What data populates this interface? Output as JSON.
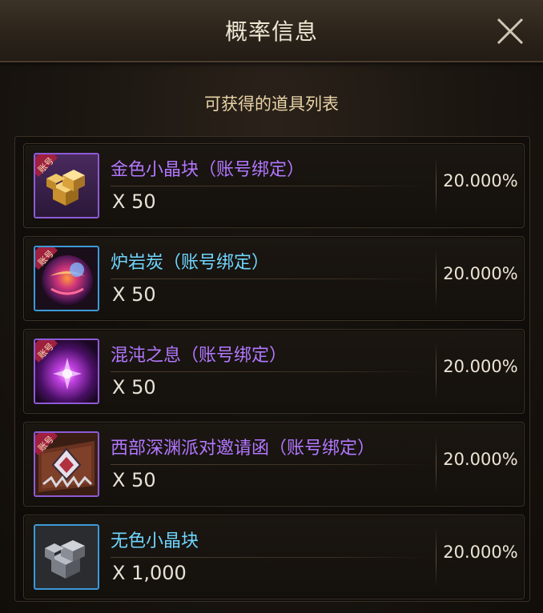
{
  "dialog": {
    "title": "概率信息",
    "subtitle": "可获得的道具列表"
  },
  "items": [
    {
      "name": "金色小晶块（账号绑定）",
      "quantity": "X 50",
      "probability": "20.000%",
      "name_color": "#b277ff",
      "frame_color": "#8c5bd6",
      "badge": "账号",
      "icon": "gold-crystal-blocks-icon"
    },
    {
      "name": "炉岩炭（账号绑定）",
      "quantity": "X 50",
      "probability": "20.000%",
      "name_color": "#6fd6ff",
      "frame_color": "#3c9ad8",
      "badge": "账号",
      "icon": "lava-coal-orb-icon"
    },
    {
      "name": "混沌之息（账号绑定）",
      "quantity": "X 50",
      "probability": "20.000%",
      "name_color": "#b277ff",
      "frame_color": "#8c5bd6",
      "badge": "账号",
      "icon": "chaos-breath-icon"
    },
    {
      "name": "西部深渊派对邀请函（账号绑定）",
      "quantity": "X 50",
      "probability": "20.000%",
      "name_color": "#b277ff",
      "frame_color": "#8c5bd6",
      "badge": "账号",
      "icon": "invitation-letter-icon"
    },
    {
      "name": "无色小晶块",
      "quantity": "X 1,000",
      "probability": "20.000%",
      "name_color": "#6fd6ff",
      "frame_color": "#3c9ad8",
      "badge": "",
      "icon": "colorless-crystal-blocks-icon"
    }
  ]
}
